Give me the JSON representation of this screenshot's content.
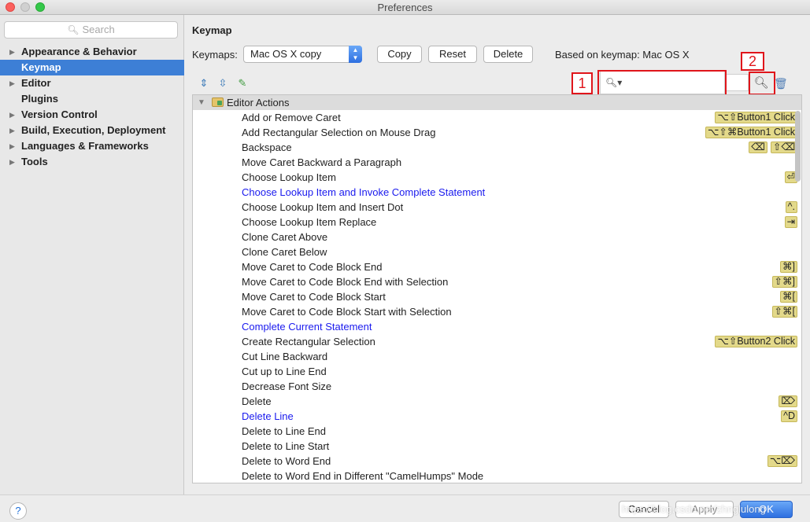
{
  "window": {
    "title": "Preferences"
  },
  "sidebar": {
    "search_placeholder": "Search",
    "items": [
      {
        "label": "Appearance & Behavior",
        "expandable": true,
        "active": false
      },
      {
        "label": "Keymap",
        "expandable": false,
        "active": true
      },
      {
        "label": "Editor",
        "expandable": true,
        "active": false
      },
      {
        "label": "Plugins",
        "expandable": false,
        "active": false
      },
      {
        "label": "Version Control",
        "expandable": true,
        "active": false
      },
      {
        "label": "Build, Execution, Deployment",
        "expandable": true,
        "active": false
      },
      {
        "label": "Languages & Frameworks",
        "expandable": true,
        "active": false
      },
      {
        "label": "Tools",
        "expandable": true,
        "active": false
      }
    ]
  },
  "main": {
    "title": "Keymap",
    "keymaps_label": "Keymaps:",
    "keymap_value": "Mac OS X copy",
    "copy_label": "Copy",
    "reset_label": "Reset",
    "delete_label": "Delete",
    "based_on": "Based on keymap: Mac OS X",
    "filter_value": "",
    "annotation_1": "1",
    "annotation_2": "2"
  },
  "tree": {
    "group": "Editor Actions",
    "actions": [
      {
        "name": "Add or Remove Caret",
        "shortcuts": [
          "⌥⇧Button1 Click"
        ],
        "blue": false
      },
      {
        "name": "Add Rectangular Selection on Mouse Drag",
        "shortcuts": [
          "⌥⇧⌘Button1 Click"
        ],
        "blue": false
      },
      {
        "name": "Backspace",
        "shortcuts": [
          "⌫",
          "⇧⌫"
        ],
        "blue": false
      },
      {
        "name": "Move Caret Backward a Paragraph",
        "shortcuts": [],
        "blue": false
      },
      {
        "name": "Choose Lookup Item",
        "shortcuts": [
          "⏎"
        ],
        "blue": false
      },
      {
        "name": "Choose Lookup Item and Invoke Complete Statement",
        "shortcuts": [],
        "blue": true
      },
      {
        "name": "Choose Lookup Item and Insert Dot",
        "shortcuts": [
          "^."
        ],
        "blue": false
      },
      {
        "name": "Choose Lookup Item Replace",
        "shortcuts": [
          "⇥"
        ],
        "blue": false
      },
      {
        "name": "Clone Caret Above",
        "shortcuts": [],
        "blue": false
      },
      {
        "name": "Clone Caret Below",
        "shortcuts": [],
        "blue": false
      },
      {
        "name": "Move Caret to Code Block End",
        "shortcuts": [
          "⌘]"
        ],
        "blue": false
      },
      {
        "name": "Move Caret to Code Block End with Selection",
        "shortcuts": [
          "⇧⌘]"
        ],
        "blue": false
      },
      {
        "name": "Move Caret to Code Block Start",
        "shortcuts": [
          "⌘["
        ],
        "blue": false
      },
      {
        "name": "Move Caret to Code Block Start with Selection",
        "shortcuts": [
          "⇧⌘["
        ],
        "blue": false
      },
      {
        "name": "Complete Current Statement",
        "shortcuts": [],
        "blue": true
      },
      {
        "name": "Create Rectangular Selection",
        "shortcuts": [
          "⌥⇧Button2 Click"
        ],
        "blue": false
      },
      {
        "name": "Cut Line Backward",
        "shortcuts": [],
        "blue": false
      },
      {
        "name": "Cut up to Line End",
        "shortcuts": [],
        "blue": false
      },
      {
        "name": "Decrease Font Size",
        "shortcuts": [],
        "blue": false
      },
      {
        "name": "Delete",
        "shortcuts": [
          "⌦"
        ],
        "blue": false
      },
      {
        "name": "Delete Line",
        "shortcuts": [
          "^D"
        ],
        "blue": true
      },
      {
        "name": "Delete to Line End",
        "shortcuts": [],
        "blue": false
      },
      {
        "name": "Delete to Line Start",
        "shortcuts": [],
        "blue": false
      },
      {
        "name": "Delete to Word End",
        "shortcuts": [
          "⌥⌦"
        ],
        "blue": false
      },
      {
        "name": "Delete to Word End in Different \"CamelHumps\" Mode",
        "shortcuts": [],
        "blue": false
      }
    ]
  },
  "footer": {
    "help_label": "?",
    "cancel_label": "Cancel",
    "apply_label": "Apply",
    "ok_label": "OK",
    "watermark": "https://blog.csdn.net/zhnglulong"
  },
  "icons": {
    "expand_all": "expand-all-icon",
    "collapse_all": "collapse-all-icon",
    "edit": "pencil-icon",
    "find_shortcut": "find-by-shortcut-icon",
    "trash": "trash-icon"
  },
  "colors": {
    "accent": "#3d7fd6",
    "annotation": "#e0151b",
    "shortcut_badge": "#e3d98a",
    "link_blue": "#1a1aee"
  }
}
